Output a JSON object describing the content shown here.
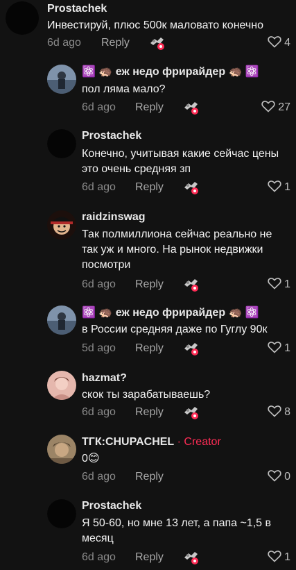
{
  "comments": [
    {
      "author": "Prostachek",
      "text": "Инвестируй, плюс 500к маловато конечно",
      "time": "6d ago",
      "reply": "Reply",
      "likes": "4",
      "avatar_color": "#000000"
    },
    {
      "author": "⚛️ 🦔 еж недо фрирайдер 🦔 ⚛️",
      "text": "пол ляма мало?",
      "time": "6d ago",
      "reply": "Reply",
      "likes": "27",
      "avatar_color": "#6a7d95"
    },
    {
      "author": "Prostachek",
      "text": "Конечно, учитывая какие сейчас цены это очень средняя зп",
      "time": "6d ago",
      "reply": "Reply",
      "likes": "1",
      "avatar_color": "#000000"
    },
    {
      "author": "raidzinswag",
      "text": "Так полмиллиона сейчас реально не так уж и много. На рынок недвижки посмотри",
      "time": "6d ago",
      "reply": "Reply",
      "likes": "1",
      "avatar_color": "#3a1c14"
    },
    {
      "author": "⚛️ 🦔 еж недо фрирайдер 🦔 ⚛️",
      "text": "в России средняя даже по Гуглу 90к",
      "time": "5d ago",
      "reply": "Reply",
      "likes": "1",
      "avatar_color": "#6a7d95"
    },
    {
      "author": "hazmat?",
      "text": "скок ты зарабатываешь?",
      "time": "6d ago",
      "reply": "Reply",
      "likes": "8",
      "avatar_color": "#d9a79c"
    },
    {
      "author": "ТГК:CHUPACHEL",
      "creator_label": " · Creator",
      "text": "0😊",
      "time": "6d ago",
      "reply": "Reply",
      "likes": "0",
      "avatar_color": "#8b7355"
    },
    {
      "author": "Prostachek",
      "text": "Я 50-60, но мне 13 лет, а папа ~1,5 в месяц",
      "time": "6d ago",
      "reply": "Reply",
      "likes": "1",
      "avatar_color": "#000000"
    }
  ],
  "icons": {
    "duet": "duet-sticker-icon",
    "like": "heart-outline-icon"
  }
}
